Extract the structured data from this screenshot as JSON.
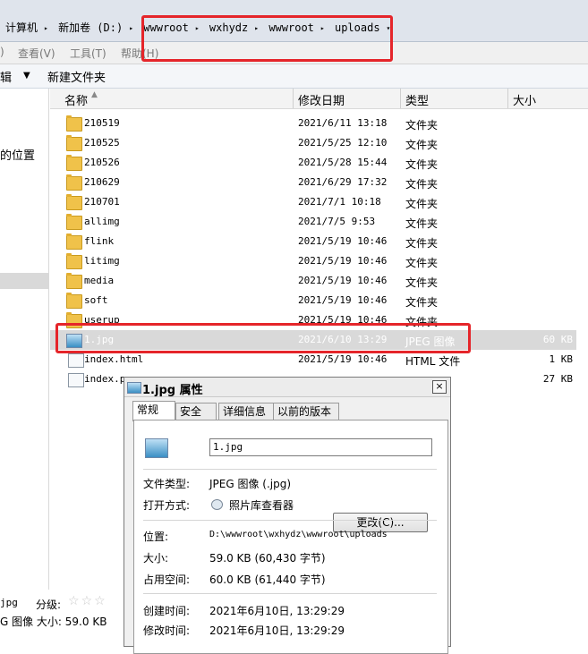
{
  "address": {
    "crumbs": [
      "计算机",
      "新加卷 (D:)",
      "wwwroot",
      "wxhydz",
      "wwwroot",
      "uploads"
    ]
  },
  "menu": {
    "items": [
      "查看(V)",
      "工具(T)",
      "帮助(H)"
    ]
  },
  "toolbar": {
    "partial_label": "辑",
    "new_folder": "新建文件夹"
  },
  "leftnav": {
    "partial_label": "的位置"
  },
  "columns": {
    "name": "名称",
    "date": "修改日期",
    "type": "类型",
    "size": "大小"
  },
  "files": [
    {
      "name": "210519",
      "date": "2021/6/11 13:18",
      "type": "文件夹",
      "size": "",
      "icon": "folder"
    },
    {
      "name": "210525",
      "date": "2021/5/25 12:10",
      "type": "文件夹",
      "size": "",
      "icon": "folder"
    },
    {
      "name": "210526",
      "date": "2021/5/28 15:44",
      "type": "文件夹",
      "size": "",
      "icon": "folder"
    },
    {
      "name": "210629",
      "date": "2021/6/29 17:32",
      "type": "文件夹",
      "size": "",
      "icon": "folder"
    },
    {
      "name": "210701",
      "date": "2021/7/1 10:18",
      "type": "文件夹",
      "size": "",
      "icon": "folder"
    },
    {
      "name": "allimg",
      "date": "2021/7/5 9:53",
      "type": "文件夹",
      "size": "",
      "icon": "folder"
    },
    {
      "name": "flink",
      "date": "2021/5/19 10:46",
      "type": "文件夹",
      "size": "",
      "icon": "folder"
    },
    {
      "name": "litimg",
      "date": "2021/5/19 10:46",
      "type": "文件夹",
      "size": "",
      "icon": "folder"
    },
    {
      "name": "media",
      "date": "2021/5/19 10:46",
      "type": "文件夹",
      "size": "",
      "icon": "folder"
    },
    {
      "name": "soft",
      "date": "2021/5/19 10:46",
      "type": "文件夹",
      "size": "",
      "icon": "folder"
    },
    {
      "name": "userup",
      "date": "2021/5/19 10:46",
      "type": "文件夹",
      "size": "",
      "icon": "folder"
    },
    {
      "name": "1.jpg",
      "date": "2021/6/10 13:29",
      "type": "JPEG 图像",
      "size": "60 KB",
      "icon": "image",
      "selected": true
    },
    {
      "name": "index.html",
      "date": "2021/5/19 10:46",
      "type": "HTML 文件",
      "size": "1 KB",
      "icon": "doc"
    },
    {
      "name": "index.p",
      "date": "",
      "type": "",
      "size": "27 KB",
      "icon": "doc"
    }
  ],
  "status": {
    "filename_partial": "jpg",
    "rating_label": "分级:",
    "type_size": "G 图像  大小: 59.0 KB"
  },
  "dialog": {
    "title": "1.jpg 属性",
    "close": "×",
    "tabs": [
      "常规",
      "安全",
      "详细信息",
      "以前的版本"
    ],
    "filename": "1.jpg",
    "file_type_label": "文件类型:",
    "file_type_value": "JPEG 图像 (.jpg)",
    "open_with_label": "打开方式:",
    "open_with_value": "照片库查看器",
    "change_button": "更改(C)...",
    "location_label": "位置:",
    "location_value": "D:\\wwwroot\\wxhydz\\wwwroot\\uploads",
    "size_label": "大小:",
    "size_value": "59.0 KB (60,430 字节)",
    "disk_label": "占用空间:",
    "disk_value": "60.0 KB (61,440 字节)",
    "created_label": "创建时间:",
    "created_value": "2021年6月10日, 13:29:29",
    "modified_label": "修改时间:",
    "modified_value": "2021年6月10日, 13:29:29"
  },
  "colors": {
    "highlight": "#e5252a",
    "selection": "#d9d9d9",
    "folder": "#f0c24a"
  }
}
